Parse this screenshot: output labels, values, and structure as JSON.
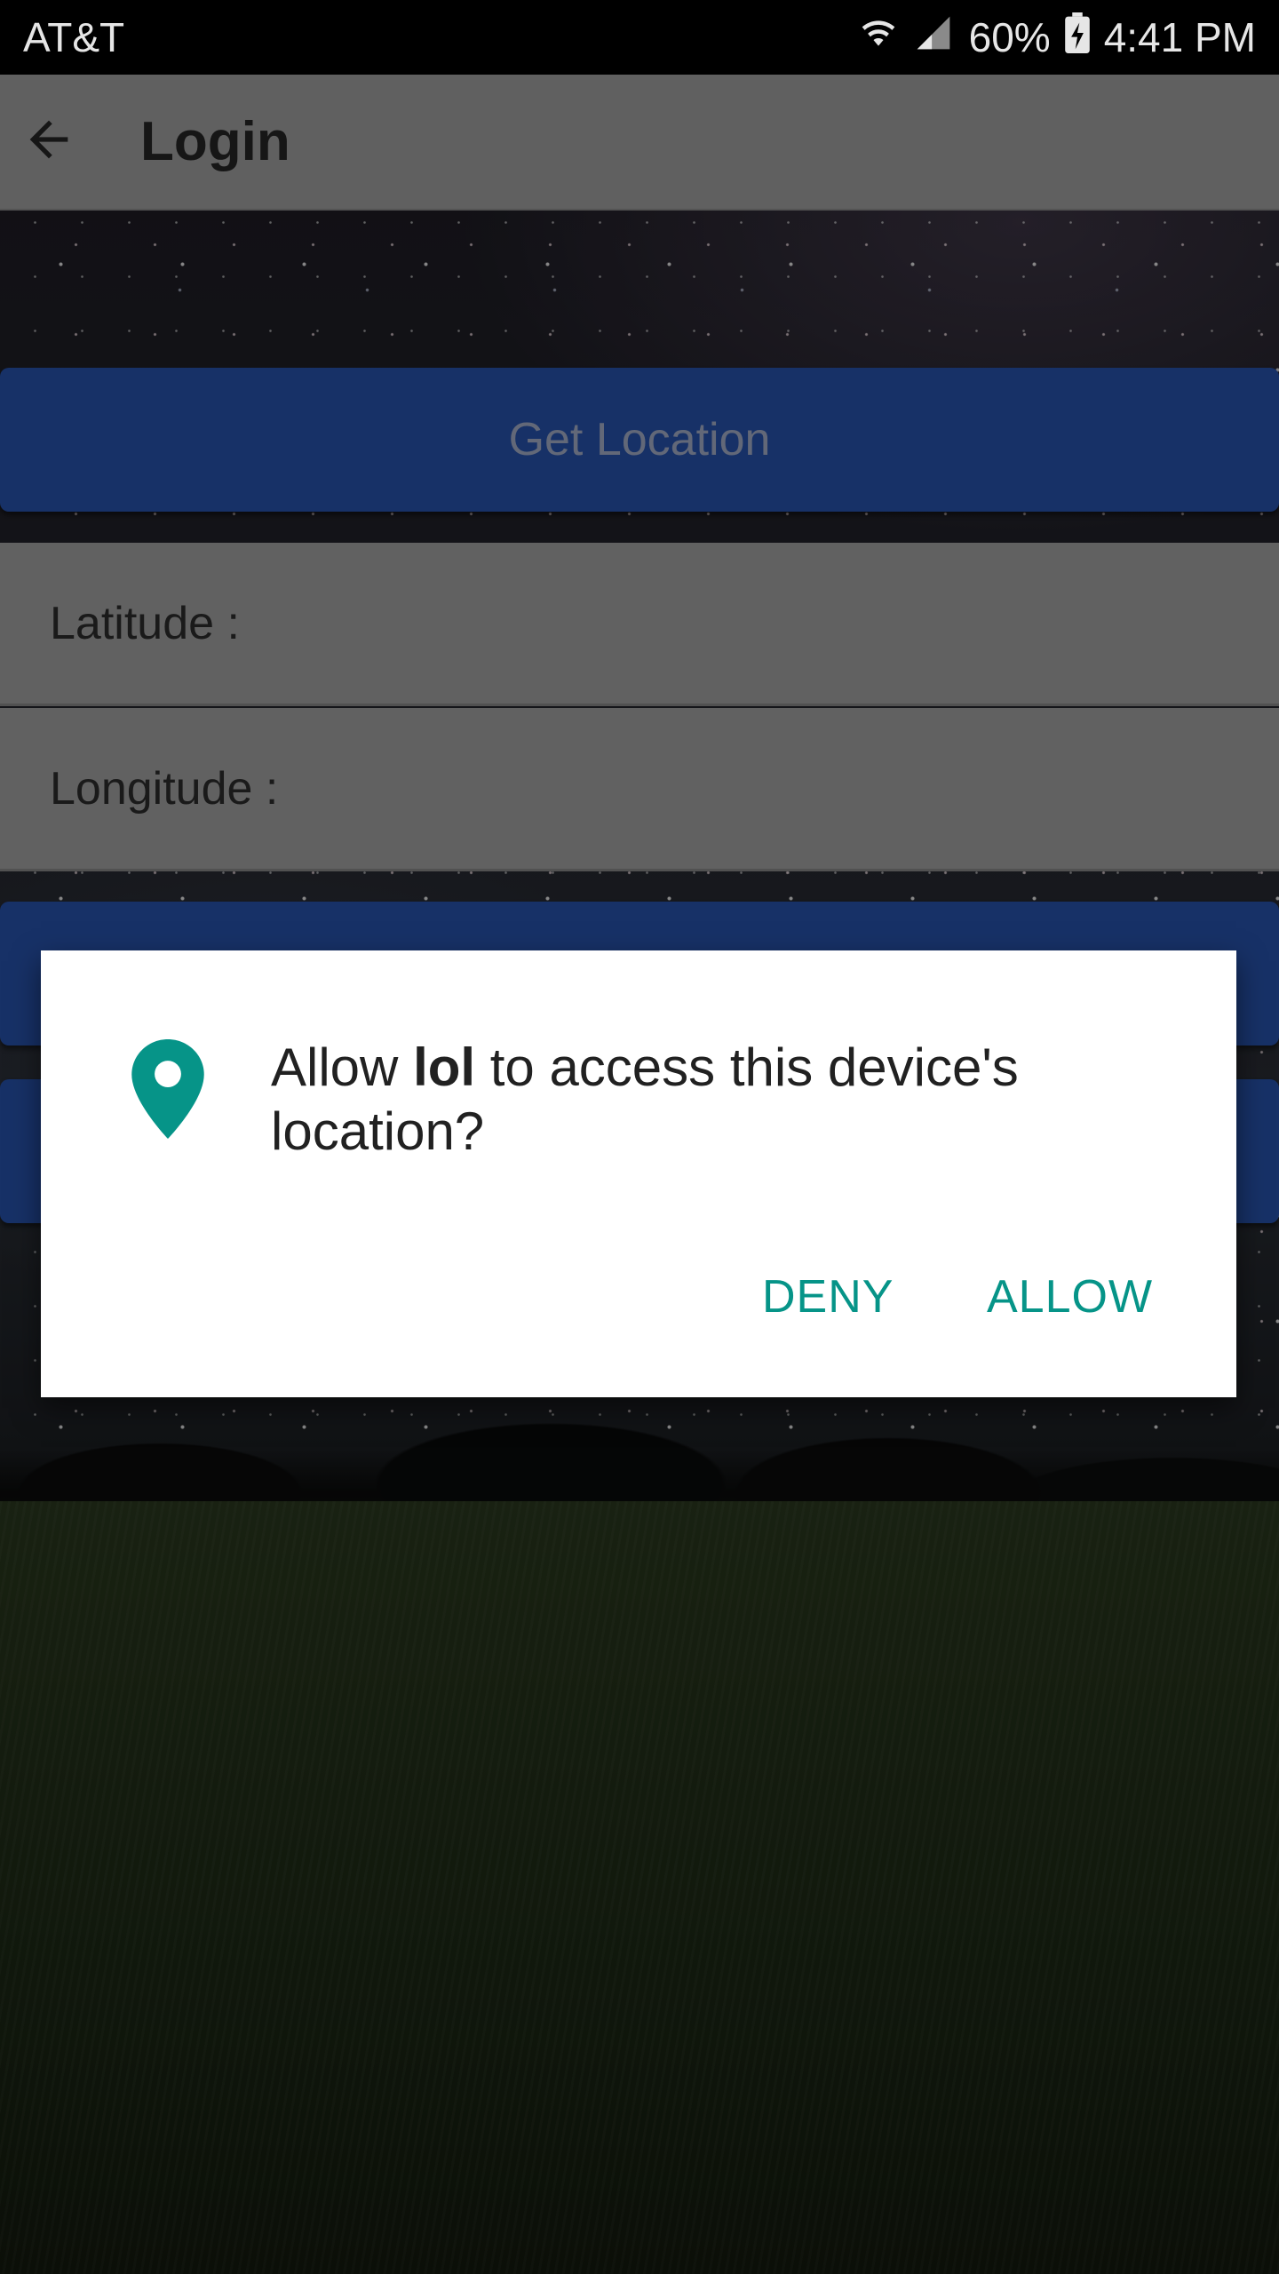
{
  "status_bar": {
    "carrier": "AT&T",
    "battery": "60%",
    "time": "4:41 PM",
    "icons": [
      "wifi-icon",
      "signal-icon",
      "battery-charging-icon"
    ]
  },
  "app_bar": {
    "back_icon": "arrow-back-icon",
    "title": "Login"
  },
  "main": {
    "get_location_label": "Get Location",
    "latitude_label": "Latitude :",
    "longitude_label": "Longitude :"
  },
  "dialog": {
    "icon": "location-pin-icon",
    "message_prefix": "Allow ",
    "app_name": "lol",
    "message_suffix": " to access this device's location?",
    "deny_label": "DENY",
    "allow_label": "ALLOW"
  },
  "colors": {
    "primary_button": "#2955b2",
    "dialog_accent": "#069488",
    "app_bar": "#a6a6a6"
  }
}
